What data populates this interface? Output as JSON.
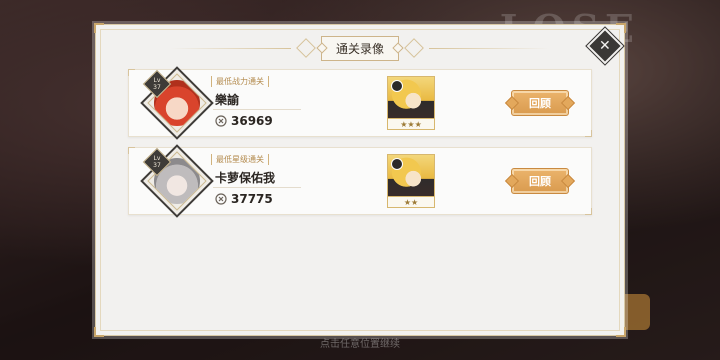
{
  "background": {
    "logo_text": "LOSE",
    "hint_text": "点击任意位置继续"
  },
  "dialog": {
    "title": "通关录像",
    "close_icon": "close-x-icon"
  },
  "records": [
    {
      "tag": "最低战力通关",
      "player_name": "樂諭",
      "power": "36969",
      "level_label": "Lv",
      "level": "37",
      "unit_stars": "★★★",
      "review_label": "回顾",
      "portrait": "red-haired-hero-portrait"
    },
    {
      "tag": "最低星级通关",
      "player_name": "卡萝保佑我",
      "power": "37775",
      "level_label": "Lv",
      "level": "37",
      "unit_stars": "★★",
      "review_label": "回顾",
      "portrait": "silver-haired-hero-portrait"
    }
  ],
  "colors": {
    "accent": "#d99a4e",
    "panel_bg": "#f2f1ef",
    "dark_frame": "#3e3b38"
  }
}
